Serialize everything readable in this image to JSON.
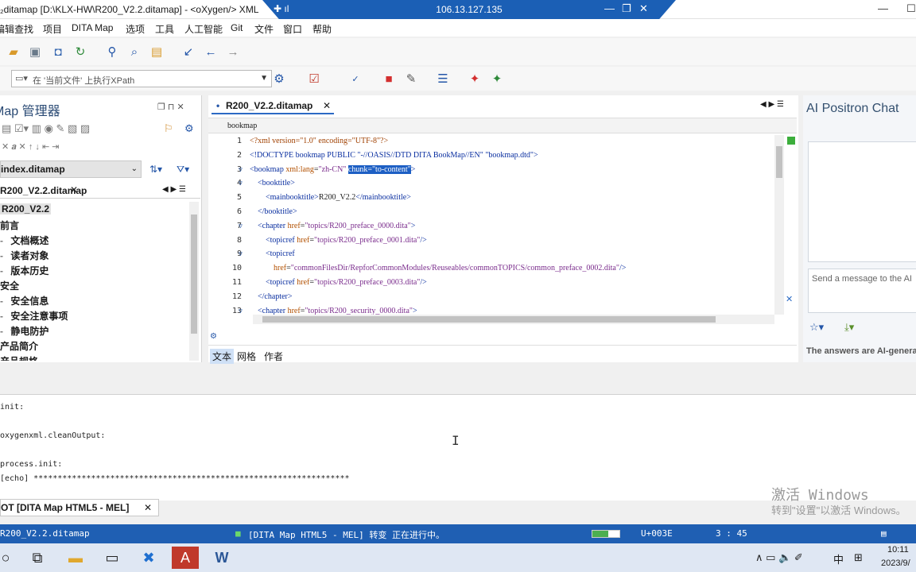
{
  "window": {
    "title": "₂ditamap [D:\\KLX-HW\\R200_V2.2.ditamap] - <oXygen/> XML",
    "remote_ip": "106.13.127.135",
    "remote_controls": [
      "—",
      "❐",
      "✕"
    ],
    "win_controls": [
      "—",
      "☐"
    ]
  },
  "menu": [
    "编辑",
    "查找",
    "项目",
    "DITA Map",
    "选项",
    "工具",
    "人工智能",
    "Git",
    "文件",
    "窗口",
    "帮助"
  ],
  "xpath": {
    "placeholder": "在 '当前文件' 上执行XPath"
  },
  "left_panel": {
    "title": "Map 管理器",
    "map_selector": "index.ditamap",
    "tab": "R200_V2.2.ditamap",
    "tree": [
      {
        "label": "R200_V2.2",
        "level": 0,
        "selected": true
      },
      {
        "label": "前言",
        "level": 0
      },
      {
        "label": "文档概述",
        "level": 1
      },
      {
        "label": "读者对象",
        "level": 1
      },
      {
        "label": "版本历史",
        "level": 1
      },
      {
        "label": "安全",
        "level": 0
      },
      {
        "label": "安全信息",
        "level": 1
      },
      {
        "label": "安全注意事项",
        "level": 1
      },
      {
        "label": "静电防护",
        "level": 1
      },
      {
        "label": "产品简介",
        "level": 0
      },
      {
        "label": "产品规格",
        "level": 0
      }
    ]
  },
  "editor": {
    "tab": "R200_V2.2.ditamap",
    "breadcrumb": "bookmap",
    "modes": [
      "文本",
      "网格",
      "作者"
    ],
    "active_mode": "文本",
    "lines": [
      {
        "n": "1",
        "html": "<span class='pi'>&lt;?xml version=\"1.0\" encoding=\"UTF-8\"?&gt;</span>"
      },
      {
        "n": "2",
        "html": "<span class='tag'>&lt;!DOCTYPE bookmap PUBLIC \"-//OASIS//DTD DITA BookMap//EN\" \"bookmap.dtd\"&gt;</span>"
      },
      {
        "n": "3",
        "html": "<span class='tag'>&lt;bookmap</span> <span class='an'>xml:lang</span>=<span class='av'>\"zh-CN\"</span> <span style='background:#1d5fc4;color:#fff'>chunk=\"to-content\"</span><span class='tag'>&gt;</span>"
      },
      {
        "n": "4",
        "html": "    <span class='tag'>&lt;booktitle&gt;</span>"
      },
      {
        "n": "5",
        "html": "        <span class='tag'>&lt;mainbooktitle&gt;</span>R200_V2.2<span class='tag'>&lt;/mainbooktitle&gt;</span>"
      },
      {
        "n": "6",
        "html": "    <span class='tag'>&lt;/booktitle&gt;</span>"
      },
      {
        "n": "7",
        "html": "    <span class='tag'>&lt;chapter</span> <span class='an'>href</span>=<span class='av'>\"topics/R200_preface_0000.dita\"</span><span class='tag'>&gt;</span>"
      },
      {
        "n": "8",
        "html": "        <span class='tag'>&lt;topicref</span> <span class='an'>href</span>=<span class='av'>\"topics/R200_preface_0001.dita\"</span><span class='tag'>/&gt;</span>"
      },
      {
        "n": "9",
        "html": "        <span class='tag'>&lt;topicref</span>"
      },
      {
        "n": "10",
        "html": "            <span class='an'>href</span>=<span class='av'>\"commonFilesDir/RepforCommonModules/Reuseables/commonTOPICS/common_preface_0002.dita\"</span><span class='tag'>/&gt;</span>"
      },
      {
        "n": "11",
        "html": "        <span class='tag'>&lt;topicref</span> <span class='an'>href</span>=<span class='av'>\"topics/R200_preface_0003.dita\"</span><span class='tag'>/&gt;</span>"
      },
      {
        "n": "12",
        "html": "    <span class='tag'>&lt;/chapter&gt;</span>"
      },
      {
        "n": "13",
        "html": "    <span class='tag'>&lt;chapter</span> <span class='an'>href</span>=<span class='av'>\"topics/R200_security_0000.dita\"</span><span class='tag'>&gt;</span>"
      }
    ]
  },
  "chat": {
    "title": "AI Positron Chat",
    "input_placeholder": "Send a message to the AI",
    "disclaimer": "The answers are AI-generated"
  },
  "console": {
    "lines": [
      "init:",
      "",
      "oxygenxml.cleanOutput:",
      "",
      "process.init:",
      "[echo] ******************************************************************"
    ],
    "tab": "DITA Map HTML5 - MEL]",
    "tab_prefix": "OT ["
  },
  "watermark": {
    "line1": "激活 Windows",
    "line2": "转到\"设置\"以激活 Windows。"
  },
  "status": {
    "file": "R200_V2.2.ditamap",
    "transform": "[DITA Map HTML5 - MEL] 转变 正在进行中。",
    "unicode": "U+003E",
    "position": "3 : 45"
  },
  "taskbar": {
    "time": "10:11",
    "date": "2023/9/",
    "ime": "中"
  }
}
